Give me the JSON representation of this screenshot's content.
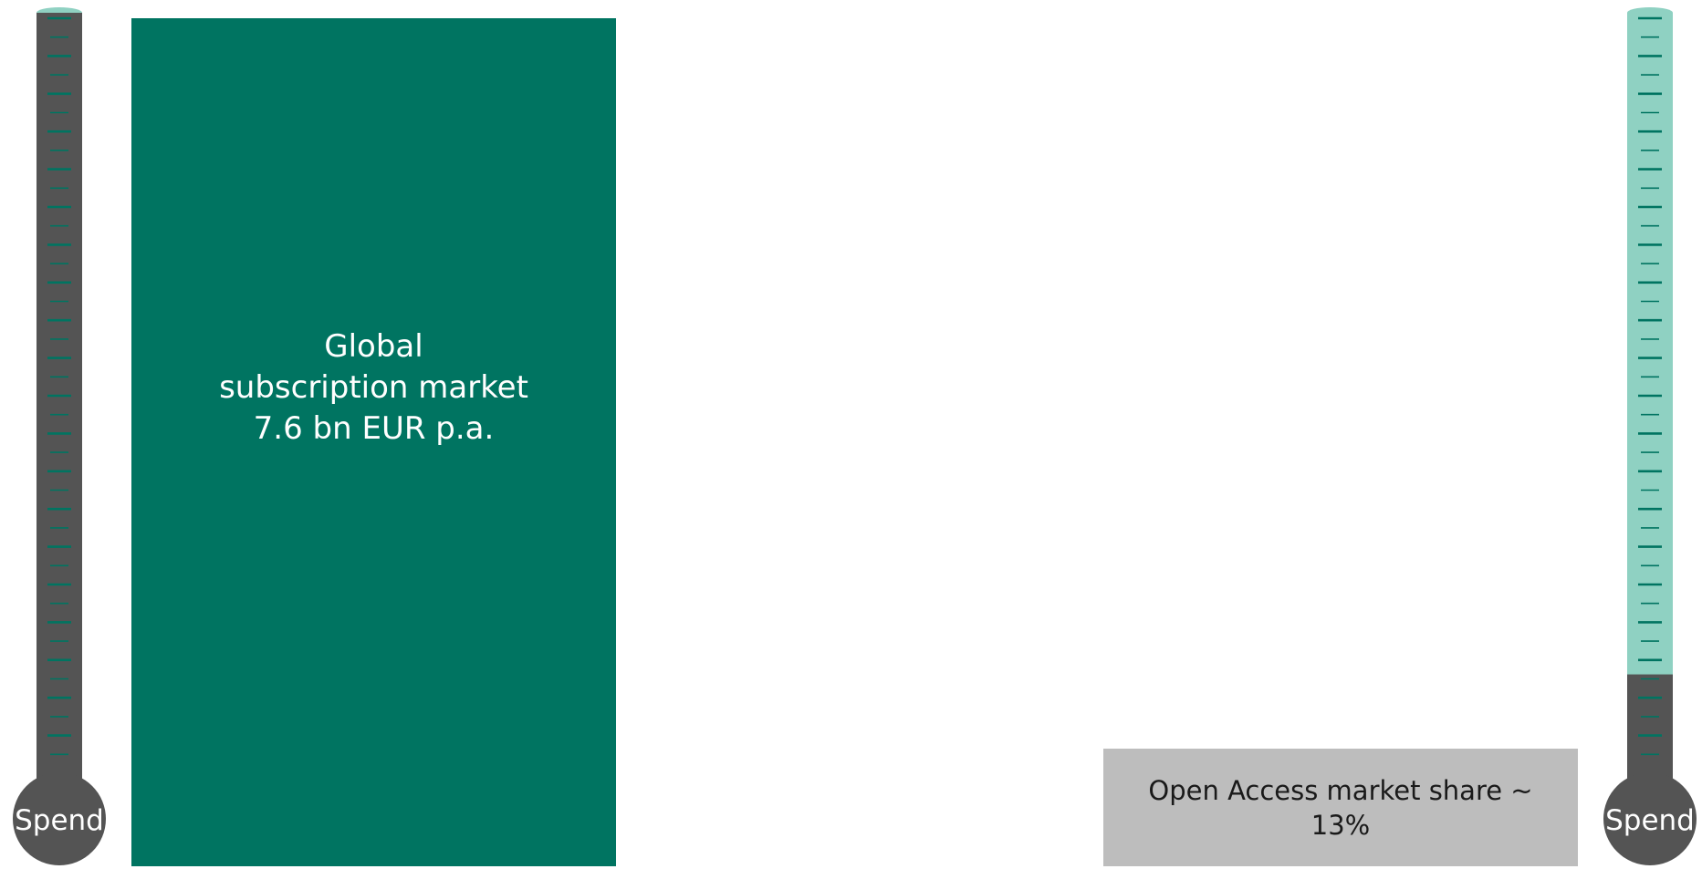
{
  "colors": {
    "subscription_fill": "#007461",
    "oa_fill": "#bdbdbd",
    "thermo_dark": "#545454",
    "thermo_light": "#8fd1c2",
    "tick": "#007461"
  },
  "left_thermometer": {
    "label": "Spend",
    "fill_level": 1.0
  },
  "right_thermometer": {
    "label": "Spend",
    "fill_level": 0.13
  },
  "subscription_block": {
    "line1": "Global",
    "line2": "subscription market",
    "line3": "7.6 bn EUR p.a."
  },
  "open_access_block": {
    "text": "Open Access market share ~ 13%",
    "share": 0.13
  }
}
